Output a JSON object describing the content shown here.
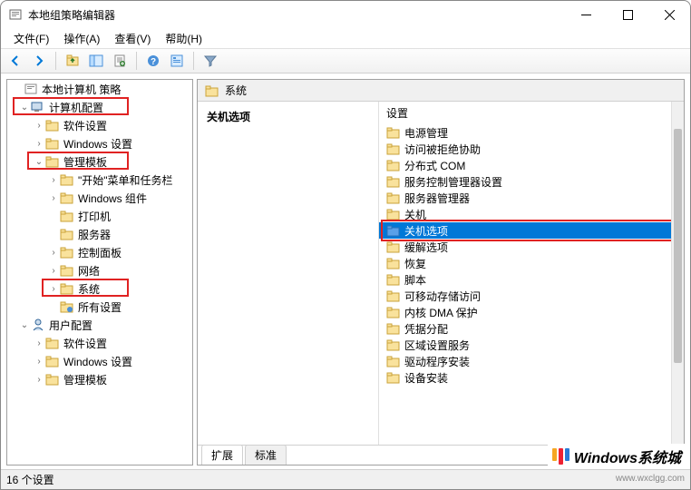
{
  "window": {
    "title": "本地组策略编辑器"
  },
  "menu": {
    "file": "文件(F)",
    "action": "操作(A)",
    "view": "查看(V)",
    "help": "帮助(H)"
  },
  "tree": {
    "root": "本地计算机 策略",
    "computercfg": "计算机配置",
    "softsettings": "软件设置",
    "winsettings": "Windows 设置",
    "admintpl": "管理模板",
    "startmenu": "\"开始\"菜单和任务栏",
    "wincomp": "Windows 组件",
    "printer": "打印机",
    "server": "服务器",
    "ctrlpanel": "控制面板",
    "network": "网络",
    "system": "系统",
    "allsettings": "所有设置",
    "usercfg": "用户配置",
    "softsettings2": "软件设置",
    "winsettings2": "Windows 设置",
    "admintpl2": "管理模板"
  },
  "location": {
    "label": "系统"
  },
  "left_heading": "关机选项",
  "right_heading": "设置",
  "items": [
    "电源管理",
    "访问被拒绝协助",
    "分布式 COM",
    "服务控制管理器设置",
    "服务器管理器",
    "关机",
    "关机选项",
    "缓解选项",
    "恢复",
    "脚本",
    "可移动存储访问",
    "内核 DMA 保护",
    "凭据分配",
    "区域设置服务",
    "驱动程序安装",
    "设备安装"
  ],
  "selected_index": 6,
  "tabs": {
    "ext": "扩展",
    "std": "标准"
  },
  "status": "16 个设置",
  "watermark": {
    "text": "Windows系统城",
    "sub": "www.wxclgg.com"
  }
}
